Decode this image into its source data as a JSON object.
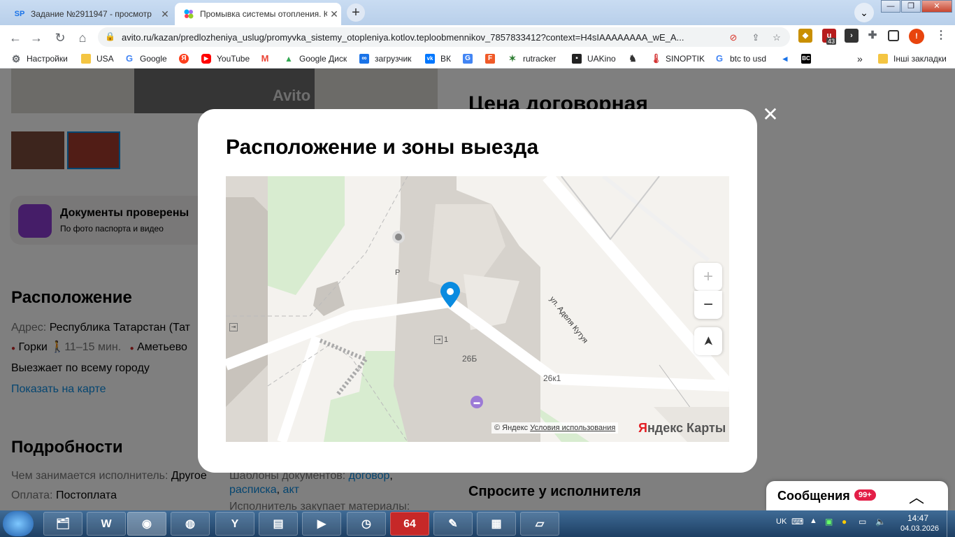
{
  "browser": {
    "tabs": [
      {
        "favicon": "SP",
        "title": "Задание №2911947 - просмотр"
      },
      {
        "favicon": "avito-icon",
        "title": "Промывка системы отопления. К"
      }
    ],
    "new_tab": "+",
    "window_controls": {
      "minimize": "—",
      "maximize": "❐",
      "close": "✕"
    },
    "url": "avito.ru/kazan/predlozheniya_uslug/promyvka_sistemy_otopleniya.kotlov.teploobmennikov_7857833412?context=H4sIAAAAAAAA_wE_A...",
    "extension_badge": "43",
    "profile_initial": "!"
  },
  "bookmarks": [
    {
      "label": "Настройки",
      "icon": "gear-icon",
      "color": "#5f6368"
    },
    {
      "label": "USA",
      "icon": "folder-icon",
      "color": "#f4c542"
    },
    {
      "label": "Google",
      "icon": "google-icon",
      "color": "#4285f4"
    },
    {
      "label": "",
      "icon": "yandex-icon",
      "color": "#fc3f1d"
    },
    {
      "label": "YouTube",
      "icon": "youtube-icon",
      "color": "#ff0000"
    },
    {
      "label": "",
      "icon": "gmail-icon",
      "color": "#ea4335"
    },
    {
      "label": "Google Диск",
      "icon": "drive-icon",
      "color": "#34a853"
    },
    {
      "label": "загрузчик",
      "icon": "loader-icon",
      "color": "#1a73e8"
    },
    {
      "label": "ВК",
      "icon": "vk-icon",
      "color": "#0077ff"
    },
    {
      "label": "",
      "icon": "translate-icon",
      "color": "#4285f4"
    },
    {
      "label": "",
      "icon": "f-icon",
      "color": "#f05a28"
    },
    {
      "label": "rutracker",
      "icon": "rutracker-icon",
      "color": "#2e7d32"
    },
    {
      "label": "UAKino",
      "icon": "uakino-icon",
      "color": "#222222"
    },
    {
      "label": "",
      "icon": "chess-icon",
      "color": "#333333"
    },
    {
      "label": "SINOPTIK",
      "icon": "thermometer-icon",
      "color": "#d32f2f"
    },
    {
      "label": "btc to usd",
      "icon": "google-icon",
      "color": "#4285f4"
    },
    {
      "label": "",
      "icon": "diamond-icon",
      "color": "#1a73e8"
    },
    {
      "label": "",
      "icon": "bc-icon",
      "color": "#000000"
    }
  ],
  "bookmarks_more": "»",
  "other_bookmarks": "Інші закладки",
  "page": {
    "avito_watermark": "Avito",
    "price": "Цена договорная",
    "docs": {
      "title": "Документы проверены",
      "subtitle": "По фото паспорта и видео"
    },
    "location_title": "Расположение",
    "address_label": "Адрес:",
    "address_value": "Республика Татарстан (Тат",
    "metro": [
      {
        "name": "Горки",
        "time": "11–15 мин."
      },
      {
        "name": "Аметьево",
        "time": ""
      }
    ],
    "travels": "Выезжает по всему городу",
    "show_on_map": "Показать на карте",
    "details_title": "Подробности",
    "does_label": "Чем занимается исполнитель:",
    "does_value": "Другое",
    "payment_label": "Оплата:",
    "payment_value": "Постоплата",
    "templates_label": "Шаблоны документов:",
    "templates_links": [
      "договор",
      "расписка",
      "акт"
    ],
    "purchase_cut": "Исполнитель закупает материалы:",
    "ask_title": "Спросите у исполнителя"
  },
  "modal": {
    "title": "Расположение и зоны выезда",
    "close": "✕",
    "map": {
      "street": "ул. Аделя Кутуя",
      "labels": [
        "26Б",
        "26к1",
        "1",
        "P"
      ],
      "zoom_in": "+",
      "zoom_out": "−",
      "locate": "➤",
      "attribution_prefix": "© Яндекс",
      "attribution_link": "Условия использования",
      "logo_red": "Я",
      "logo_rest": "ндекс Карты"
    }
  },
  "messages": {
    "label": "Сообщения",
    "badge": "99+",
    "chevron": "︿"
  },
  "taskbar": {
    "lang": "UK",
    "time": "14:47",
    "date": "04.03.2026",
    "apps": [
      "start",
      "explorer",
      "shield",
      "chrome",
      "globe",
      "yandex",
      "terminal",
      "media",
      "clock",
      "64",
      "paint",
      "monitor",
      "notes"
    ]
  }
}
